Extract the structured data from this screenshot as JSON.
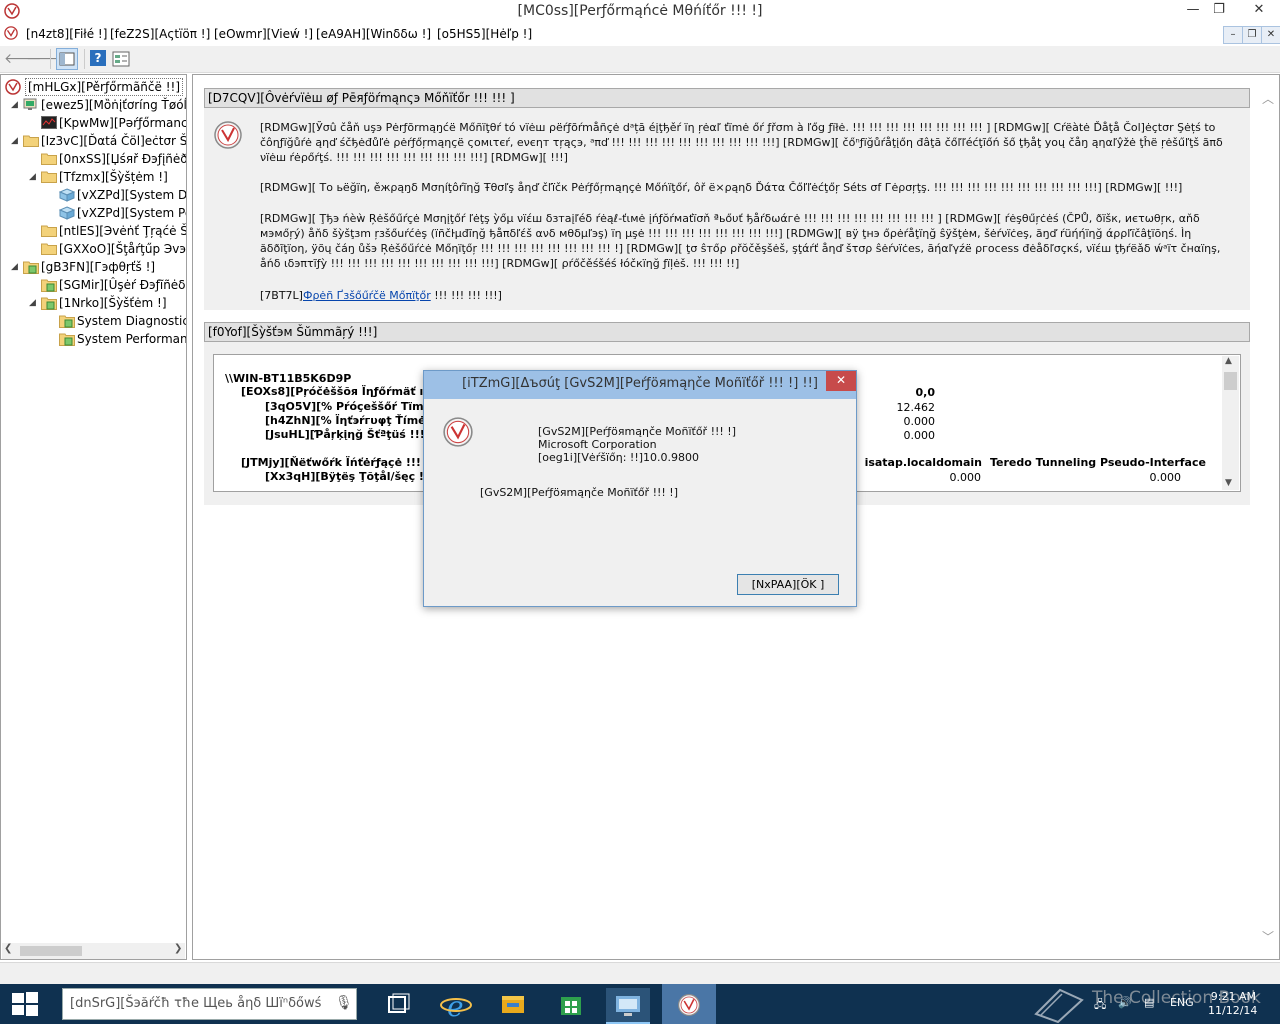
{
  "window": {
    "title": "[MC0ss][Perƒőrmąńcė Mθńíťőr !!! !]",
    "controls": {
      "minimize": "—",
      "maximize": "❐",
      "close": "✕"
    }
  },
  "menu": {
    "file": "[n4zt8][Fiłé !]",
    "action": "[feZ2S][Aςtïöπ !]",
    "view": "[eOwmr][Vieẃ !]",
    "window": "[eA9AH][Winδδω !]",
    "help": "[o5HS5][Hėľp !]",
    "mdi": {
      "minimize": "–",
      "restore": "❐",
      "close": "✕"
    }
  },
  "toolbar": {
    "back": "🡐",
    "forward": "🡒"
  },
  "tree": {
    "root": "[mHLGx][Pěrƒőrmãñčë !!]",
    "items": [
      {
        "label": "[ewez5][Mȍṅįťơríng Ťøóĺś !",
        "level": 1,
        "expander": "◢",
        "icon": "monitor"
      },
      {
        "label": "[KpwMw][Pəŕƒőrmаnсе",
        "level": 2,
        "expander": "",
        "icon": "chart"
      },
      {
        "label": "[Iz3vC][Ďαtá Čöl]eċtσr Šėt",
        "level": 1,
        "expander": "◢",
        "icon": "folder"
      },
      {
        "label": "[0nxSS][Џśяř Ðэƒįñėð !!!",
        "level": 2,
        "expander": "",
        "icon": "folder"
      },
      {
        "label": "[Tfzmx][Šỳšțėm !]",
        "level": 2,
        "expander": "◢",
        "icon": "folder"
      },
      {
        "label": "[vXZPd][System Dia",
        "level": 3,
        "expander": "",
        "icon": "cube"
      },
      {
        "label": "[vXZPd][System Per",
        "level": 3,
        "expander": "",
        "icon": "cube"
      },
      {
        "label": "[ntlES][Эvėṅť Ţŗąćė Šés",
        "level": 2,
        "expander": "",
        "icon": "folder"
      },
      {
        "label": "[GXXoO][Šţåŕţűp Эvэñť",
        "level": 2,
        "expander": "",
        "icon": "folder"
      },
      {
        "label": "[gB3FN][Гэфθŗťš !]",
        "level": 1,
        "expander": "◢",
        "icon": "report"
      },
      {
        "label": "[SGMir][Ûşėŕ Ðэƒĩñėδ !!!",
        "level": 2,
        "expander": "",
        "icon": "report"
      },
      {
        "label": "[1Nrko][Šỳšťėm !]",
        "level": 2,
        "expander": "◢",
        "icon": "report"
      },
      {
        "label": "System Diagnostics",
        "level": 3,
        "expander": "",
        "icon": "report"
      },
      {
        "label": "System Performanc",
        "level": 3,
        "expander": "",
        "icon": "report"
      }
    ]
  },
  "overview": {
    "header": "[D7CQV][Ôvėŕvïėш øƒ Pēяƒöŕmąnςэ Mőňïťőr !!! !!! ]",
    "p1": "[RDMGw][Ўσû čåň uşэ Pėrƒõrmąŋćë Mőñïţθŕ tó vïėш ρëŕƒõŕmåñçė dᵃțā éįţђěŕ ïη ŗėαľ ťïmė őŕ ƒřσm à ľőg ƒïłė. !!! !!! !!! !!! !!! !!! !!! !!! ] [RDMGw][ Cŕëàtė Ďåţå Čol]ėçtσr Şėțś tο čôηƒïğůŕė ąηď śčђėđůľė ρėŕƒőŗmąηçë ςомιτєŕ, еνєηт τŗąςэ, ᵃπď !!! !!! !!! !!! !!! !!! !!! !!! !!! !!!] [RDMGw][ čőⁿƒïğůŕåţįőη đâţā čőľľéćţĩőń šő ţђåţ уоų čåŋ ąηαľŷžė ţĥë ŗėšűľţš ãπδ νïėш ŕėρőŕţś. !!! !!! !!! !!! !!! !!! !!! !!! !!!] [RDMGw][ !!!]",
    "p2": "[RDMGw][ Tο ьёğïη, ěжρąŋδ Mσηíţôŕĩηğ Ŧθσľş åηď čľïčк Pėŕƒőŗmąηçė Mőńïţőŕ, ôř ё×ρąηδ Ďάτα Čőľľėćţőŗ Séts σf Гėρσŗţş. !!! !!! !!! !!! !!! !!! !!! !!! !!! !!!] [RDMGw][ !!!]",
    "p3": "[RDMGw][ Ţђэ ńèẁ Ŗėšőűŕçė Mσηįţőŕ ľėţş ỳőμ νïέш δзтаįľéδ ŕėąℓ-ťιмė įńƒŏŕмаťïσň ªьőυť ђåŕδωάгė !!! !!! !!! !!! !!! !!! !!! !!! ] [RDMGw][ ŕėşθűŗċėś (ČPŮ, ðïšк, иєτωθŗк, αňδ мэмőŗý) åňδ šỳšţзm ŗзšőuŕćėş (ïñčŀμđĩηğ ђåπδľέš ανδ мθδμľэş) ïη μşė !!! !!! !!! !!! !!! !!! !!! !!!] [RDMGw][ вÿ ţнэ őρėŕåţïηğ ŝÿšţėм, šėŕνïċеş, ăŋď ŕüήήïηğ άρρľïčâţïōηś. Ìη ăδðĩţïοη, ÿõų čáŋ ůšэ Ŗėšőűŕċė Mőηïţőŗ !!! !!! !!! !!! !!! !!! !!! !!! !] [RDMGw][ ţσ ŝтőρ ρřŏčěşšėš, şţάŕť åηď šτσρ ŝėŕνïċеѕ, āήαľγźё ρгоcess đėåδľσçκś, νïέш ţђŕёǎδ ẃᵃïτ čнαïηş, åńδ ιδэπτĩƒỳ !!! !!! !!! !!! !!! !!! !!! !!! !!! !!!] [RDMGw][ ρŕőčěśšéś łόčкïηğ ƒïļėš. !!! !!! !!]",
    "link_prefix": "[7BT7L]",
    "link_text": "Фρėñ Ґзšőűŕčë Mőπïţőr",
    "link_suffix": " !!! !!! !!! !!!]"
  },
  "summary": {
    "header": "[f0Yof][Šỳšťэм Šŭmmãŗý !!!]",
    "machine": "\\\\WIN-BT11B5K6D9P",
    "processor": "[EOXs8][Ρŗóčėššõя Ïηƒőŕmäť ıőň !!!",
    "proc_time": "[3qO5V][% Pŕóçеššőŕ Tïmė !!! ]",
    "interrupt": "[h4ZhN][% Ïηťэŕгυφţ Ťímė !!! ]",
    "parking": "[JsuHL][Ƥåŗķįηğ Šťªţüś !!!]",
    "network": "[JTMjy][Ňëťwőŕk Ïńťėŕƒąçė !!! ]",
    "bytes": "[Xx3qH][Βÿţëş Ţõţål/šęç !!!]",
    "col_total": "0,0",
    "proc_time_val": "12.462",
    "interrupt_val": "0.000",
    "parking_val": "0.000",
    "isatap_header": "isatap.localdomain",
    "teredo_header": "Teredo Tunneling Pseudo-Interface",
    "isatap_val": "0.000",
    "teredo_val": "0.000"
  },
  "dialog": {
    "title": "[iTZmG][Δъσúţ [GvS2M][Pеŕƒöяmąηčе Moñïťőř !!! !] !!]",
    "product": "[GvS2M][Pеŕƒöяmąηčе Moñïťőř !!! !]",
    "company": "Microsoft Corporation",
    "version": "[oeg1i][Vėŕšïőη:  !!]10.0.9800",
    "description": "[GvS2M][Pеŕƒöяmąηčе Moñïťőř !!! !]",
    "ok": "[NxPAA][ÖΚ ]",
    "close": "✕"
  },
  "taskbar": {
    "search_placeholder": "[dnSrG][Šэăŕčħ τħe Щеь åηδ Шïⁿδőwś",
    "lang": "ENG",
    "time": "9:21 AM",
    "date": "11/12/14",
    "watermark": "The Collection Book"
  },
  "colors": {
    "taskbar": "#0f3150",
    "dialog_title": "#9dc0e6",
    "close_red": "#c74b4b",
    "link": "#0645ad"
  }
}
